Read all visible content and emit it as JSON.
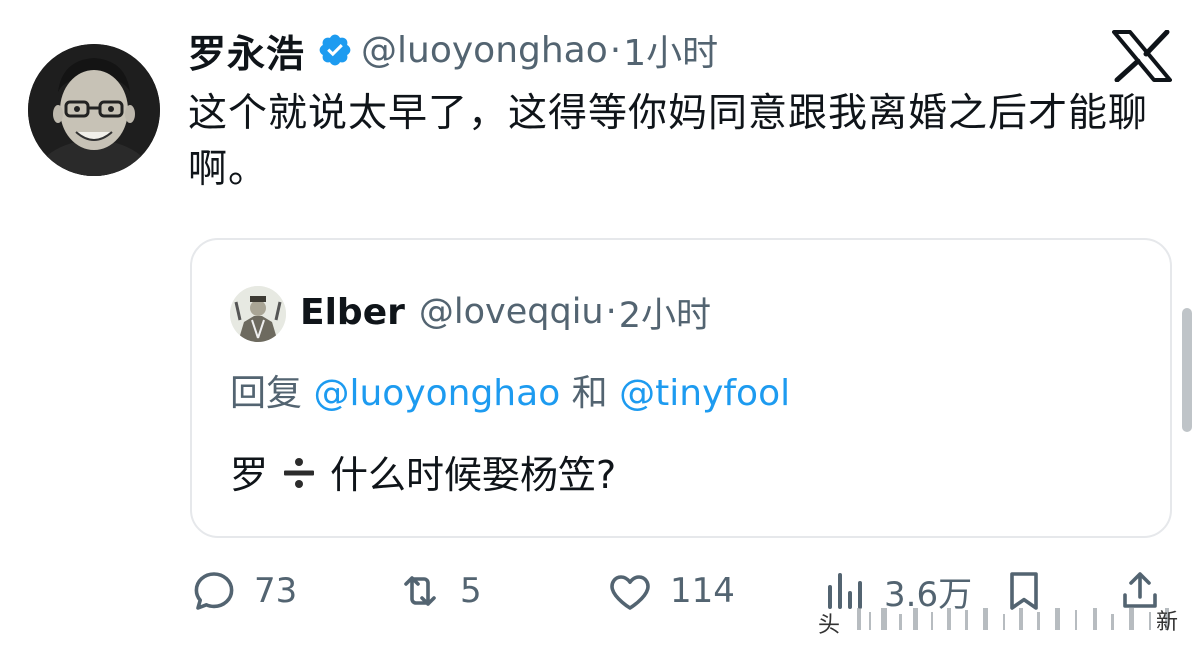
{
  "tweet": {
    "author_name": "罗永浩",
    "author_handle": "@luoyonghao",
    "separator": "·",
    "time": "1小时",
    "text": "这个就说太早了，这得等你妈同意跟我离婚之后才能聊啊。",
    "icons": {
      "verified": "verified-badge-icon",
      "platform": "x-logo-icon"
    }
  },
  "quoted": {
    "author_name": "Elber",
    "author_handle": "@loveqqiu",
    "separator": "·",
    "time": "2小时",
    "reply_prefix": "回复",
    "reply_mention_1": "@luoyonghao",
    "reply_conj": "和",
    "reply_mention_2": "@tinyfool",
    "text_before": "罗",
    "emoji": "divide-emoji",
    "text_after": "什么时候娶杨笠?"
  },
  "actions": {
    "replies": "73",
    "retweets": "5",
    "likes": "114",
    "views": "3.6万"
  },
  "watermark": {
    "left": "头",
    "right": "新"
  },
  "colors": {
    "text": "#0f1419",
    "secondary": "#536471",
    "accent": "#1d9bf0",
    "border": "#e6e8eb"
  }
}
